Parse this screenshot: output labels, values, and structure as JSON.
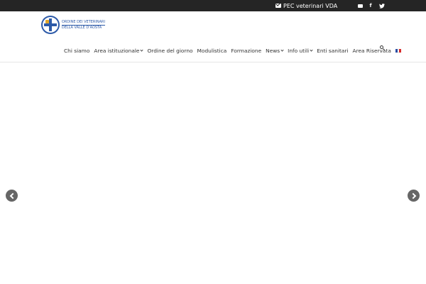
{
  "topbar": {
    "pec_label": "PEC veterinari VDA",
    "social_icons": [
      "envelope-icon",
      "facebook-icon",
      "twitter-icon"
    ],
    "background": "#252525"
  },
  "logo": {
    "line1": "ORDINE DEI VETERINARI",
    "line2": "DELLA VALLE D'AOSTA",
    "brand_color": "#2d5aa8"
  },
  "nav": {
    "items": [
      {
        "label": "Chi siamo",
        "dropdown": false
      },
      {
        "label": "Area istituzionale",
        "dropdown": true
      },
      {
        "label": "Ordine del giorno",
        "dropdown": false
      },
      {
        "label": "Modulistica",
        "dropdown": false
      },
      {
        "label": "Formazione",
        "dropdown": false
      },
      {
        "label": "News",
        "dropdown": true
      },
      {
        "label": "Info utili",
        "dropdown": true
      },
      {
        "label": "Enti sanitari",
        "dropdown": false
      },
      {
        "label": "Area Riservata",
        "dropdown": false
      }
    ],
    "language_flag": "french-flag-icon",
    "search_icon": "search-icon"
  },
  "slider": {
    "prev_icon": "chevron-left-icon",
    "next_icon": "chevron-right-icon"
  }
}
